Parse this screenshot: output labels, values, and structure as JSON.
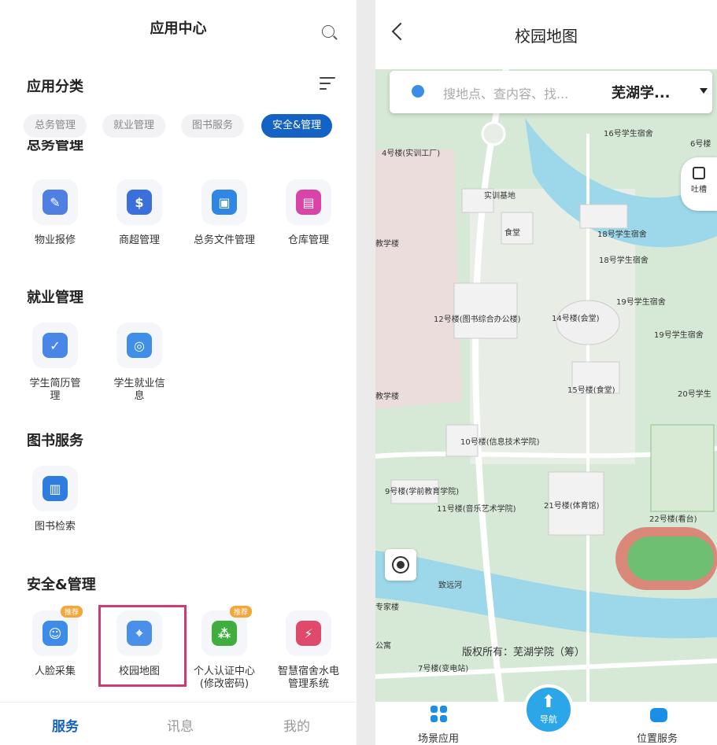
{
  "left": {
    "header": {
      "title": "应用中心"
    },
    "category_title": "应用分类",
    "chips": [
      "总务管理",
      "就业管理",
      "图书服务",
      "安全&管理"
    ],
    "active_chip": "安全&管理",
    "sections": [
      {
        "title": "总务管理",
        "apps": [
          {
            "label": "物业报修",
            "icon": "repair-icon",
            "color": "#4f7fe0"
          },
          {
            "label": "商超管理",
            "icon": "store-icon",
            "color": "#3b6fdc"
          },
          {
            "label": "总务文件管理",
            "icon": "briefcase-icon",
            "color": "#2f86e4"
          },
          {
            "label": "仓库管理",
            "icon": "warehouse-icon",
            "color": "#d844a8"
          }
        ]
      },
      {
        "title": "就业管理",
        "apps": [
          {
            "label": "学生简历管理",
            "icon": "badge-icon",
            "color": "#4a86e8"
          },
          {
            "label": "学生就业信息",
            "icon": "target-icon",
            "color": "#3f8ee8"
          }
        ]
      },
      {
        "title": "图书服务",
        "apps": [
          {
            "label": "图书检索",
            "icon": "books-icon",
            "color": "#2f7ce0"
          }
        ]
      },
      {
        "title": "安全&管理",
        "apps": [
          {
            "label": "人脸采集",
            "icon": "face-icon",
            "color": "#3f8be8",
            "badge": "推荐"
          },
          {
            "label": "校园地图",
            "icon": "map-pin-icon",
            "color": "#4a90e8"
          },
          {
            "label": "个人认证中心(修改密码)",
            "icon": "user-group-icon",
            "color": "#3fae3f",
            "badge": "推荐"
          },
          {
            "label": "智慧宿舍水电管理系统",
            "icon": "lightning-icon",
            "color": "#e04a6a"
          }
        ]
      }
    ],
    "tabs": [
      "服务",
      "讯息",
      "我的"
    ],
    "active_tab": "服务"
  },
  "right": {
    "header": {
      "title": "校园地图"
    },
    "search": {
      "placeholder": "搜地点、查内容、找...",
      "campus": "芜湖学..."
    },
    "feedback_label": "吐槽",
    "map_labels": [
      "16号学生宿舍",
      "6号楼",
      "4号楼(实训工厂)",
      "实训基地",
      "食堂",
      "18号学生宿舍",
      "18号学生宿舍",
      "教学楼",
      "19号学生宿舍",
      "12号楼(图书综合办公楼)",
      "14号楼(会堂)",
      "19号学生宿舍",
      "15号楼(食堂)",
      "20号学生",
      "教学楼",
      "10号楼(信息技术学院)",
      "9号楼(学前教育学院)",
      "11号楼(音乐艺术学院)",
      "21号楼(体育馆)",
      "22号楼(看台)",
      "致远河",
      "专家楼",
      "公寓",
      "7号楼(变电站)"
    ],
    "copyright": "版权所有：芜湖学院（筹）",
    "tabs": {
      "left": "场景应用",
      "center": "导航",
      "right": "位置服务"
    }
  }
}
